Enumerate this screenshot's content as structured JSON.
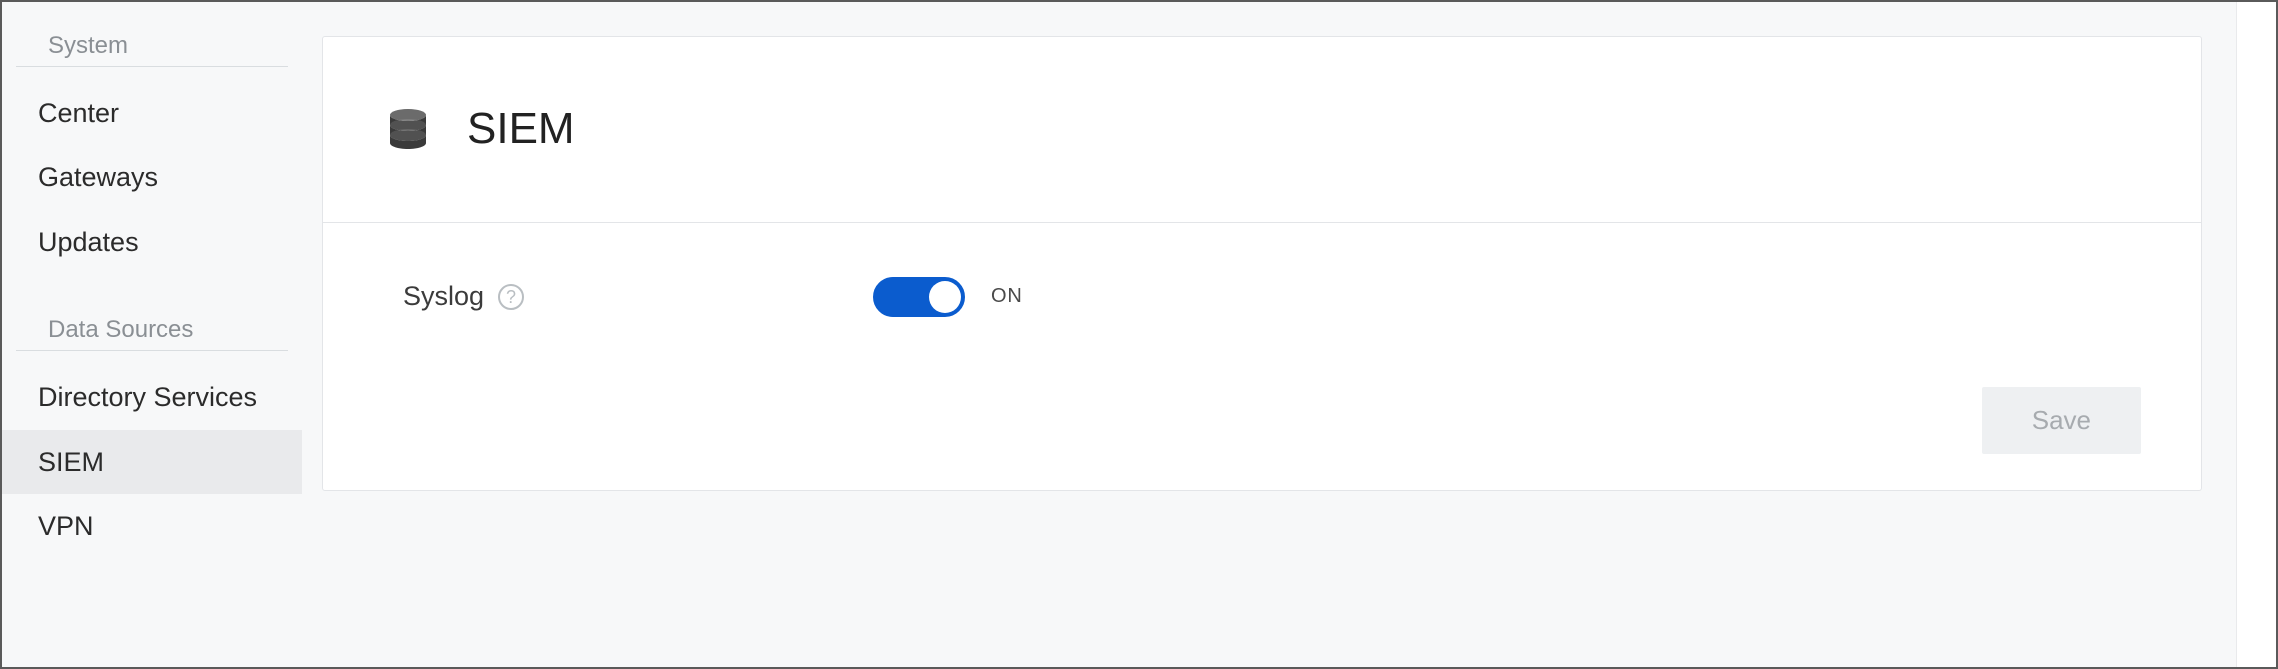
{
  "sidebar": {
    "groups": [
      {
        "label": "System",
        "items": [
          {
            "label": "Center",
            "active": false
          },
          {
            "label": "Gateways",
            "active": false
          },
          {
            "label": "Updates",
            "active": false
          }
        ]
      },
      {
        "label": "Data Sources",
        "items": [
          {
            "label": "Directory Services",
            "active": false
          },
          {
            "label": "SIEM",
            "active": true
          },
          {
            "label": "VPN",
            "active": false
          }
        ]
      }
    ]
  },
  "panel": {
    "title": "SIEM",
    "iconName": "database-icon",
    "settings": {
      "syslog": {
        "label": "Syslog",
        "helpGlyph": "?",
        "toggleOn": true,
        "toggleText": "ON"
      }
    },
    "saveLabel": "Save",
    "saveEnabled": false
  },
  "colors": {
    "toggleActive": "#0b5cce",
    "panelBorder": "#e3e5e8",
    "pageBg": "#f7f8f9"
  }
}
